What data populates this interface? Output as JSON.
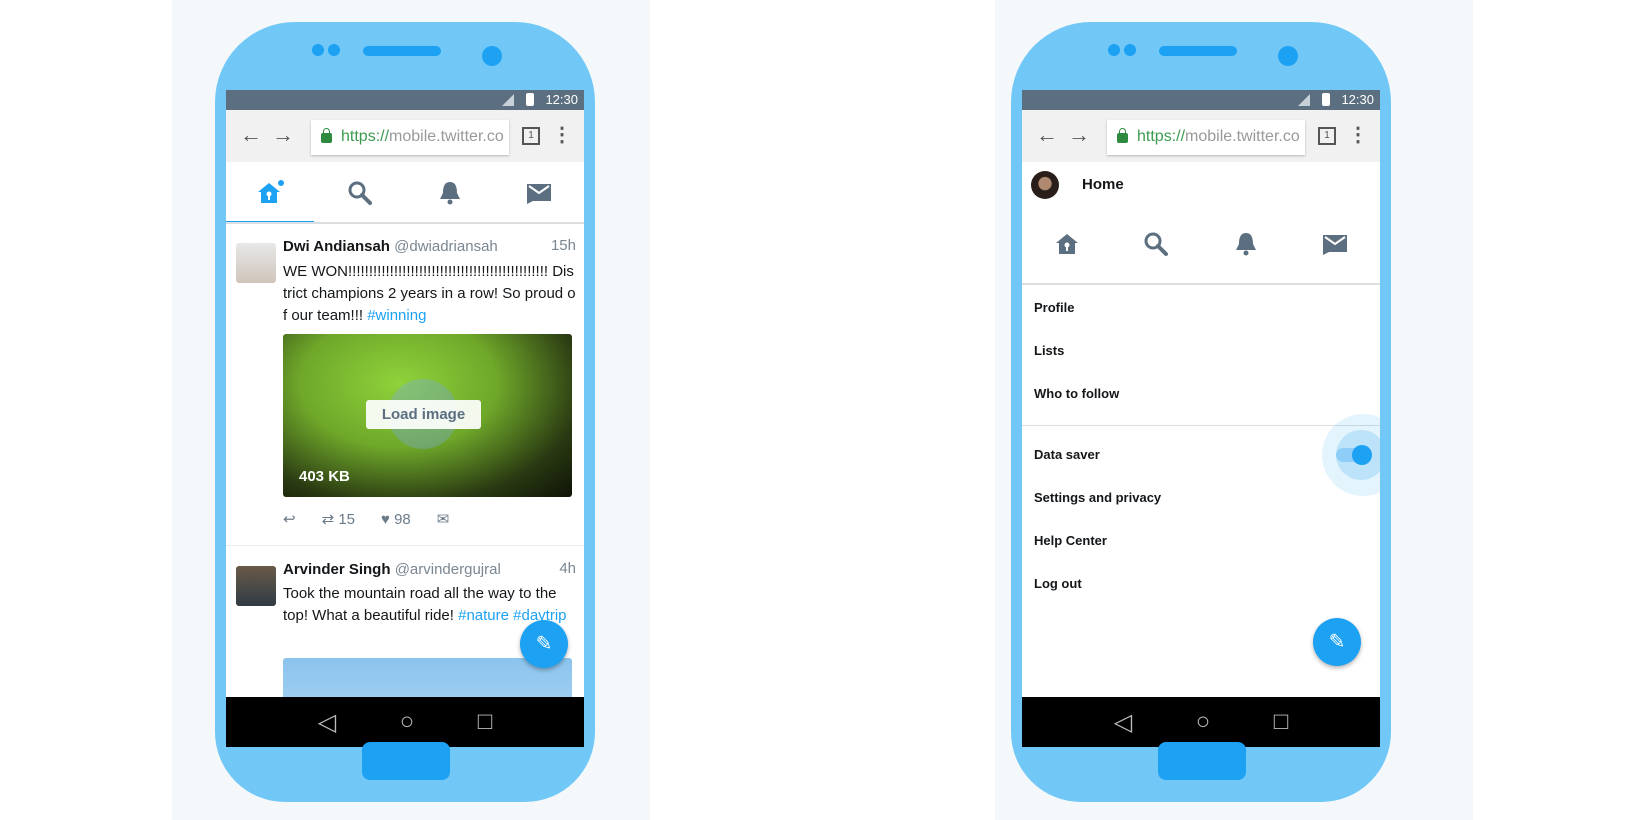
{
  "status_bar": {
    "time": "12:30"
  },
  "browser": {
    "url_scheme": "https://",
    "url_rest": "mobile.twitter.co",
    "tab_count": "1",
    "back": "←",
    "forward": "→",
    "menu": "⋮"
  },
  "colors": {
    "accent": "#1da1f2",
    "phone_body": "#71c8f7",
    "status_bar": "#5c6f80"
  },
  "nav_icons": [
    "home-icon",
    "search-icon",
    "bell-icon",
    "mail-icon"
  ],
  "timeline": {
    "tweets": [
      {
        "name": "Dwi Andiansah",
        "handle": "@dwiadriansah",
        "time": "15h",
        "text": "WE WON!!!!!!!!!!!!!!!!!!!!!!!!!!!!!!!!!!!!!!!!!!!!!!!! District champions 2 years in a row! So proud of our team!!! ",
        "hashtags": "#winning",
        "media_button": "Load image",
        "media_size": "403 KB",
        "retweets": "15",
        "likes": "98"
      },
      {
        "name": "Arvinder Singh",
        "handle": "@arvindergujral",
        "time": "4h",
        "text": "Took the mountain road all the way to the top! What a beautiful ride! ",
        "hashtags": "#nature #daytrip"
      }
    ]
  },
  "drawer": {
    "title": "Home",
    "items": [
      "Profile",
      "Lists",
      "Who to follow"
    ],
    "settings": {
      "data_saver_label": "Data saver",
      "data_saver_on": true
    },
    "items2": [
      "Settings and privacy",
      "Help Center",
      "Log out"
    ]
  },
  "android_nav": {
    "back": "◁",
    "home": "○",
    "recents": "□"
  }
}
